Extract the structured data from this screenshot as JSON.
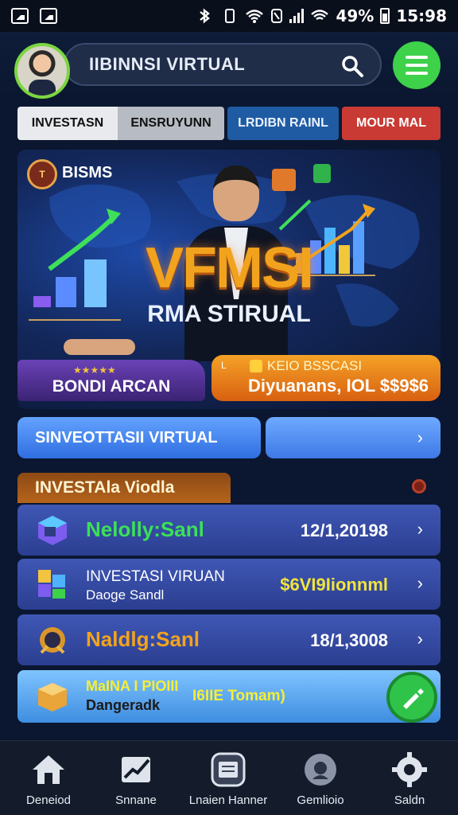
{
  "status_bar": {
    "battery": "49%",
    "time": "15:98"
  },
  "header": {
    "app_title": "IIBINNSI VIRTUAL"
  },
  "tabs": [
    {
      "label": "INVESTASN"
    },
    {
      "label": "ENSRUYUNN"
    },
    {
      "label": "LRDIBN RAINL"
    },
    {
      "label": "MOUR MAL"
    }
  ],
  "banner": {
    "badge": "T",
    "label": "BISMS",
    "title": "VFMSI",
    "subtitle": "RMA STIRUAL",
    "left_button": "BONDI ARCAN",
    "right_button_small": "L",
    "right_button_line1": "KEIO BSSCASI",
    "right_button_line2": "Diyuanans, IOL $$9$6"
  },
  "wide_button": {
    "label": "SINVEOTTASII VIRTUAL",
    "chevron": "›"
  },
  "section": {
    "title": "INVESTAla Viodla"
  },
  "list_items": [
    {
      "title": "Nelolly:Sanl",
      "value": "12/1,20198",
      "chevron": "›"
    },
    {
      "title": "INVESTASI VIRUAN",
      "subtitle": "Daoge Sandl",
      "value": "$6VI9Iionnml",
      "chevron": "›"
    },
    {
      "title": "Naldlg:Sanl",
      "value": "18/1,3008",
      "chevron": "›"
    }
  ],
  "promo": {
    "line1": "MaINA I PIOIII",
    "line2": "Dangeradk",
    "middle": "I6IIE Tomam)"
  },
  "bottom_nav": [
    {
      "label": "Deneiod",
      "icon": "home-icon"
    },
    {
      "label": "Snnane",
      "icon": "chart-icon"
    },
    {
      "label": "Lnaien Hanner",
      "icon": "ledger-icon"
    },
    {
      "label": "Gemlioio",
      "icon": "profile-icon"
    },
    {
      "label": "Saldn",
      "icon": "settings-icon"
    }
  ],
  "colors": {
    "accent_green": "#3ed14a",
    "tab_blue": "#1f5ba3",
    "tab_red": "#c93a34",
    "list_blue": "#3f57b5",
    "orange": "#f5a227"
  }
}
